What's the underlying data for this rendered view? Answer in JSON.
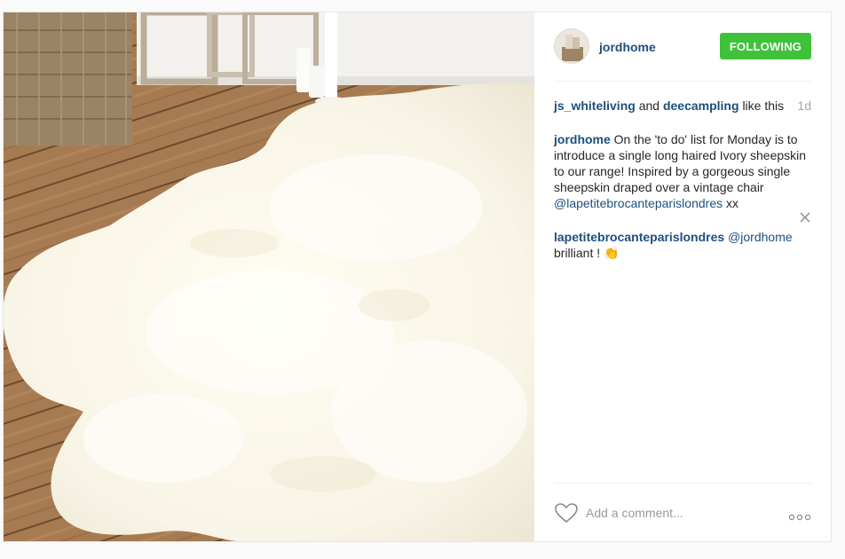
{
  "post": {
    "image_alt": "White long-haired sheepskin rug on a wooden floor",
    "header": {
      "username": "jordhome",
      "follow_label": "FOLLOWING"
    },
    "likes": {
      "user1": "js_whiteliving",
      "and_text": "and",
      "user2": "deecampling",
      "like_text": "like this",
      "age": "1d"
    },
    "caption": {
      "user": "jordhome",
      "text": "On the 'to do' list for Monday is to introduce a single long haired Ivory sheepskin to our range! Inspired by a gorgeous single sheepskin draped over a vintage chair",
      "mention": "@lapetitebrocanteparislondres",
      "suffix": "xx"
    },
    "comment": {
      "user": "lapetitebrocanteparislondres",
      "mention": "@jordhome",
      "text": "brilliant !",
      "emoji": "👏"
    },
    "footer": {
      "placeholder": "Add a comment...",
      "more_label": "more-options"
    }
  },
  "colors": {
    "link": "#1d4f7f",
    "follow_button": "#3fc23a",
    "muted": "#a5a7aa"
  }
}
